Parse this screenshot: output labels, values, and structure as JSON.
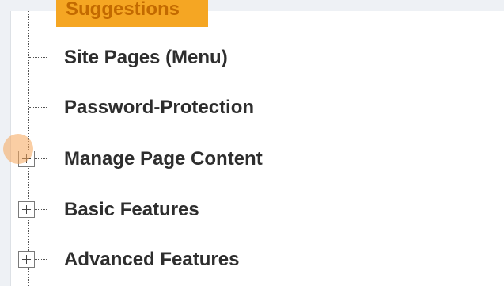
{
  "tree": {
    "highlighted": {
      "label": "Suggestions"
    },
    "items": [
      {
        "label": "Site Pages (Menu)",
        "expandable": false
      },
      {
        "label": "Password-Protection",
        "expandable": false
      },
      {
        "label": "Manage Page Content",
        "expandable": true
      },
      {
        "label": "Basic Features",
        "expandable": true
      },
      {
        "label": "Advanced Features",
        "expandable": true
      }
    ]
  },
  "colors": {
    "highlight_bg": "#f5a623",
    "highlight_text": "#c36a00",
    "item_text": "#2e2e2e",
    "page_bg": "#eef1f5",
    "cursor_marker": "#f5a65a"
  },
  "icons": {
    "expand": "plus-box-icon"
  }
}
